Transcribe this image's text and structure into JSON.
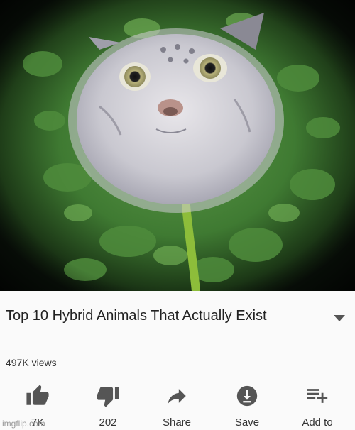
{
  "video": {
    "title": "Top 10 Hybrid Animals That Actually Exist",
    "views": "497K views"
  },
  "actions": [
    {
      "id": "like",
      "label": "7K",
      "icon": "thumbs-up-icon"
    },
    {
      "id": "dislike",
      "label": "202",
      "icon": "thumbs-down-icon"
    },
    {
      "id": "share",
      "label": "Share",
      "icon": "share-arrow-icon"
    },
    {
      "id": "save",
      "label": "Save",
      "icon": "download-circle-icon"
    },
    {
      "id": "add-to",
      "label": "Add to",
      "icon": "playlist-add-icon"
    }
  ],
  "watermark": "imgflip.com",
  "colors": {
    "background": "#fafafa",
    "text": "#222222",
    "icon": "#555555",
    "foliage": "#3f7a32",
    "stem": "#8dbd3a"
  }
}
